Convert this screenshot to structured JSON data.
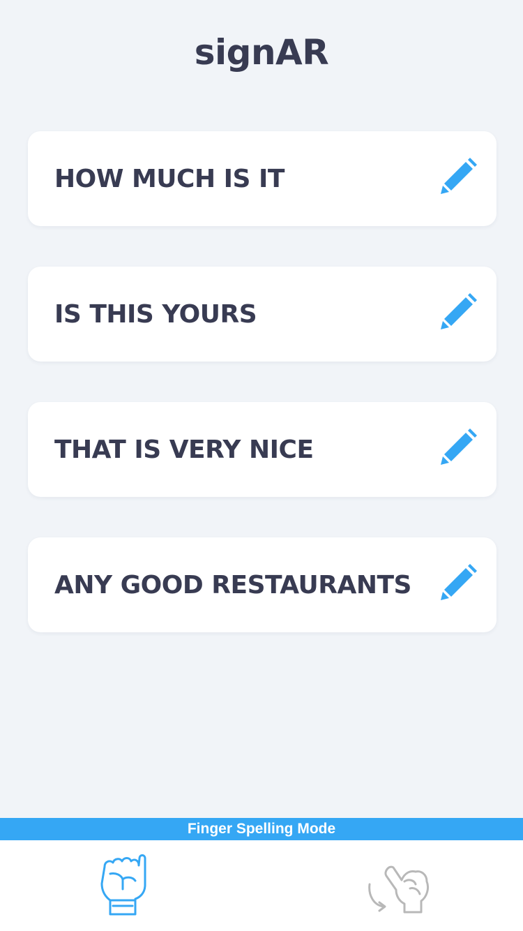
{
  "app": {
    "title": "signAR"
  },
  "phrases": [
    {
      "text": "HOW MUCH IS IT"
    },
    {
      "text": "IS THIS YOURS"
    },
    {
      "text": "THAT IS VERY NICE"
    },
    {
      "text": "ANY GOOD RESTAURANTS"
    }
  ],
  "edit_icon": "pencil-icon",
  "mode_banner": {
    "label": "Finger Spelling Mode"
  },
  "tabs": [
    {
      "icon": "fist-hand-sign-icon",
      "state": "active"
    },
    {
      "icon": "pinky-motion-hand-sign-icon",
      "state": "inactive"
    }
  ],
  "colors": {
    "accent": "#35a7f4",
    "text": "#383b52",
    "background": "#f1f4f8",
    "card": "#ffffff",
    "inactive_icon": "#b8b8b8"
  }
}
